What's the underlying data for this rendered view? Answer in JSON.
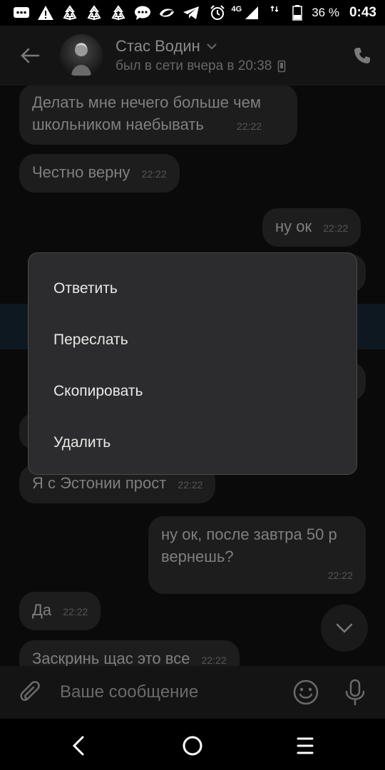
{
  "status_bar": {
    "notification_icons": [
      "message-icon",
      "warning-icon",
      "recycle-icon",
      "recycle-icon",
      "recycle-icon",
      "chat-bubble-icon",
      "brand-swirl-icon",
      "telegram-icon"
    ],
    "network": "4G",
    "battery": "36 %",
    "time": "0:43"
  },
  "header": {
    "name": "Стас Водин",
    "status": "был в сети вчера в 20:38"
  },
  "messages": [
    {
      "side": "in",
      "lines": [
        "Делать мне нечего больше чем",
        "школьником наебывать"
      ],
      "time": "22:22"
    },
    {
      "side": "in",
      "text": "Честно верну",
      "time": "22:22"
    },
    {
      "side": "out",
      "text": "ну ок",
      "time": "22:22"
    },
    {
      "side": "in",
      "text": "Я с Эстонии прост",
      "time": "22:22"
    },
    {
      "side": "out",
      "lines": [
        "ну ок, после завтра 50 р",
        "вернешь?"
      ],
      "time": "22:22"
    },
    {
      "side": "in",
      "text": "Да",
      "time": "22:22"
    },
    {
      "side": "in",
      "text": "Заскринь щас это все",
      "time": "22:22"
    }
  ],
  "input": {
    "placeholder": "Ваше сообщение"
  },
  "context_menu": {
    "items": [
      "Ответить",
      "Переслать",
      "Скопировать",
      "Удалить"
    ]
  },
  "colors": {
    "background": "#0a0a0a",
    "bubble": "#1d1d1d",
    "menu": "#2c2c2e",
    "header": "#141414"
  }
}
